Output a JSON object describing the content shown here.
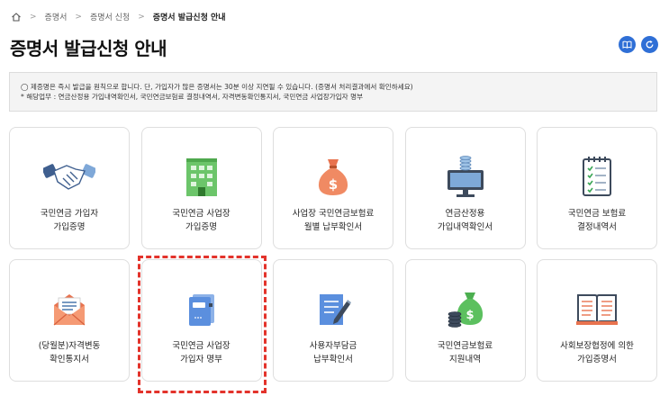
{
  "breadcrumb": {
    "items": [
      "증명서",
      "증명서 신청",
      "증명서 발급신청 안내"
    ]
  },
  "page_title": "증명서 발급신청 안내",
  "notice": {
    "line1": "◯ 제증명은 즉시 발급을 원칙으로 합니다. 단, 가입자가 많은 증명서는 30분 이상 지연될 수 있습니다. (증명서 처리결과에서 확인하세요)",
    "line2": "* 해당업무 : 연금산정용 가입내역확인서, 국민연금보험료 결정내역서, 자격변동확인통지서, 국민연금 사업장가입자 명부"
  },
  "cards": [
    {
      "line1": "국민연금 가입자",
      "line2": "가입증명",
      "icon": "handshake-icon"
    },
    {
      "line1": "국민연금 사업장",
      "line2": "가입증명",
      "icon": "building-icon"
    },
    {
      "line1": "사업장 국민연금보험료",
      "line2": "월별 납부확인서",
      "icon": "money-bag-icon"
    },
    {
      "line1": "연금산정용",
      "line2": "가입내역확인서",
      "icon": "monitor-coins-icon"
    },
    {
      "line1": "국민연금 보험료",
      "line2": "결정내역서",
      "icon": "checklist-icon"
    },
    {
      "line1": "(당월분)자격변동",
      "line2": "확인통지서",
      "icon": "envelope-icon"
    },
    {
      "line1": "국민연금 사업장",
      "line2": "가입자 명부",
      "icon": "binder-icon"
    },
    {
      "line1": "사용자부담금",
      "line2": "납부확인서",
      "icon": "document-pen-icon"
    },
    {
      "line1": "국민연금보험료",
      "line2": "지원내역",
      "icon": "coins-bag-icon"
    },
    {
      "line1": "사회보장협정에 의한",
      "line2": "가입증명서",
      "icon": "open-book-icon"
    }
  ],
  "colors": {
    "accent": "#2f6fd6",
    "highlight": "#e3332b"
  }
}
